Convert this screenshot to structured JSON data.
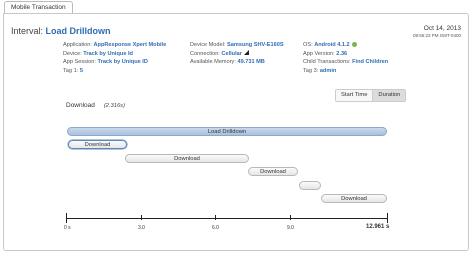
{
  "tab": {
    "label": "Mobile Transaction"
  },
  "header": {
    "interval_prefix": "Interval:",
    "interval_name": "Load Drilldown",
    "date": "Oct 14, 2013",
    "timestamp": "09:55:23 PM GMT-0400"
  },
  "meta": {
    "col1": [
      {
        "label": "Application:",
        "value": "AppResponse Xpert Mobile"
      },
      {
        "label": "Device:",
        "value": "Track by Unique Id"
      },
      {
        "label": "App Session:",
        "value": "Track by Unique ID"
      },
      {
        "label": "Tag 1:",
        "value": "5"
      }
    ],
    "col2": [
      {
        "label": "Device Model:",
        "value": "Samsung SHV-E160S"
      },
      {
        "label": "Connection:",
        "value": "Cellular"
      },
      {
        "label": "Available Memory:",
        "value": "49.731 MB"
      }
    ],
    "col3": [
      {
        "label": "OS:",
        "value": "Android 4.1.2"
      },
      {
        "label": "App Version:",
        "value": "2.36"
      },
      {
        "label": "Child Transactions:",
        "value": "Find Children"
      },
      {
        "label": "Tag 3:",
        "value": "admin"
      }
    ]
  },
  "toggle": {
    "start_time": "Start Time",
    "duration": "Duration"
  },
  "request": {
    "label": "Download",
    "duration": "(2.316s)"
  },
  "bars": {
    "main": "Load Drilldown",
    "b1": "Download",
    "b2": "Download",
    "b3": "Download",
    "b4": "",
    "b5": "Download"
  },
  "axis": {
    "t0": "0 s",
    "t1": "3.0",
    "t2": "6.0",
    "t3": "9.0",
    "end": "12.961 s"
  }
}
